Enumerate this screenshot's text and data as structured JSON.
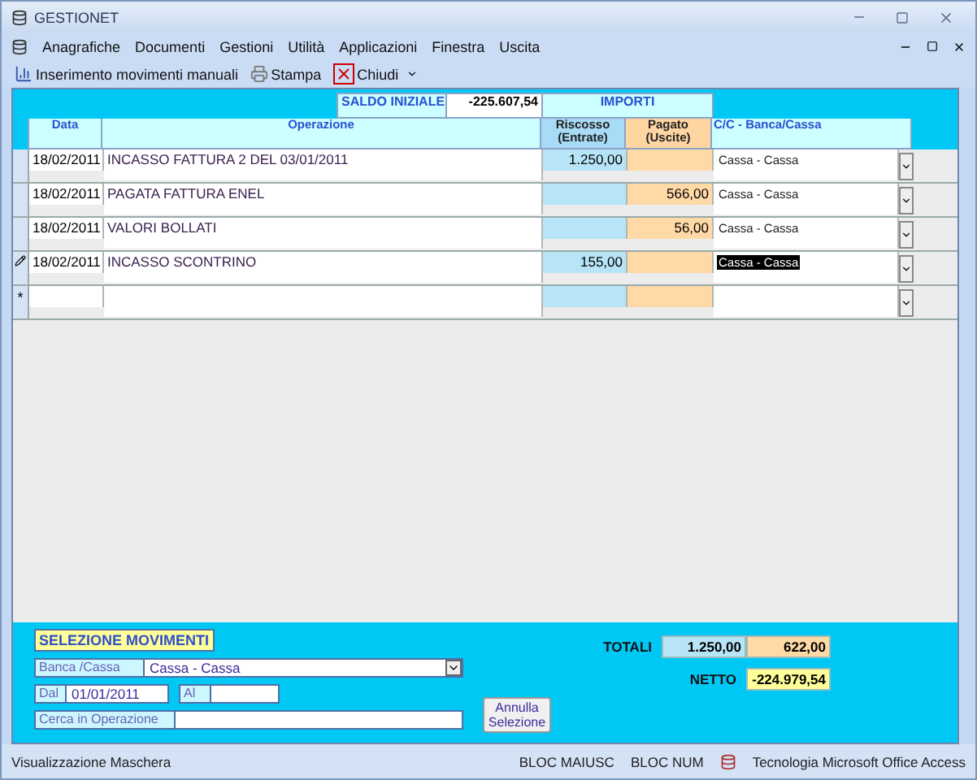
{
  "window": {
    "title": "GESTIONET"
  },
  "menu": [
    "Anagrafiche",
    "Documenti",
    "Gestioni",
    "Utilità",
    "Applicazioni",
    "Finestra",
    "Uscita"
  ],
  "toolbar": [
    {
      "label": "Inserimento movimenti manuali",
      "kind": "chart"
    },
    {
      "label": "Stampa",
      "kind": "print"
    },
    {
      "label": "Chiudi",
      "kind": "close"
    }
  ],
  "header": {
    "saldo_label": "SALDO INIZIALE",
    "saldo_value": "-225.607,54",
    "importi": "IMPORTI",
    "columns": [
      "Data",
      "Operazione",
      "Riscosso (Entrate)",
      "Pagato (Uscite)",
      "C/C - Banca/Cassa"
    ]
  },
  "rows": [
    {
      "date": "18/02/2011",
      "operation": "INCASSO FATTURA 2 DEL 03/01/2011",
      "in": "1.250,00",
      "out": "",
      "account": "Cassa - Cassa",
      "editing": false
    },
    {
      "date": "18/02/2011",
      "operation": "PAGATA FATTURA ENEL",
      "in": "",
      "out": "566,00",
      "account": "Cassa - Cassa",
      "editing": false
    },
    {
      "date": "18/02/2011",
      "operation": "VALORI BOLLATI",
      "in": "",
      "out": "56,00",
      "account": "Cassa - Cassa",
      "editing": false
    },
    {
      "date": "18/02/2011",
      "operation": "INCASSO SCONTRINO",
      "in": "155,00",
      "out": "",
      "account": "Cassa - Cassa",
      "editing": true
    }
  ],
  "new_row": {
    "marker": "*"
  },
  "footer": {
    "title": "SELEZIONE MOVIMENTI",
    "bank_label": "Banca /Cassa",
    "bank_value": "Cassa - Cassa",
    "from_label": "Dal",
    "from_value": "01/01/2011",
    "to_label": "Al",
    "search_label": "Cerca in Operazione",
    "reset_button": "Annulla Selezione",
    "totals_label": "TOTALI",
    "total_in": "1.250,00",
    "total_out": "622,00",
    "net_label": "NETTO",
    "net_value": "-224.979,54"
  },
  "status": {
    "text": "Visualizzazione Maschera",
    "indicators": [
      "BLOC MAIUSC",
      "BLOC NUM"
    ],
    "app": "Tecnologia Microsoft Office Access"
  }
}
